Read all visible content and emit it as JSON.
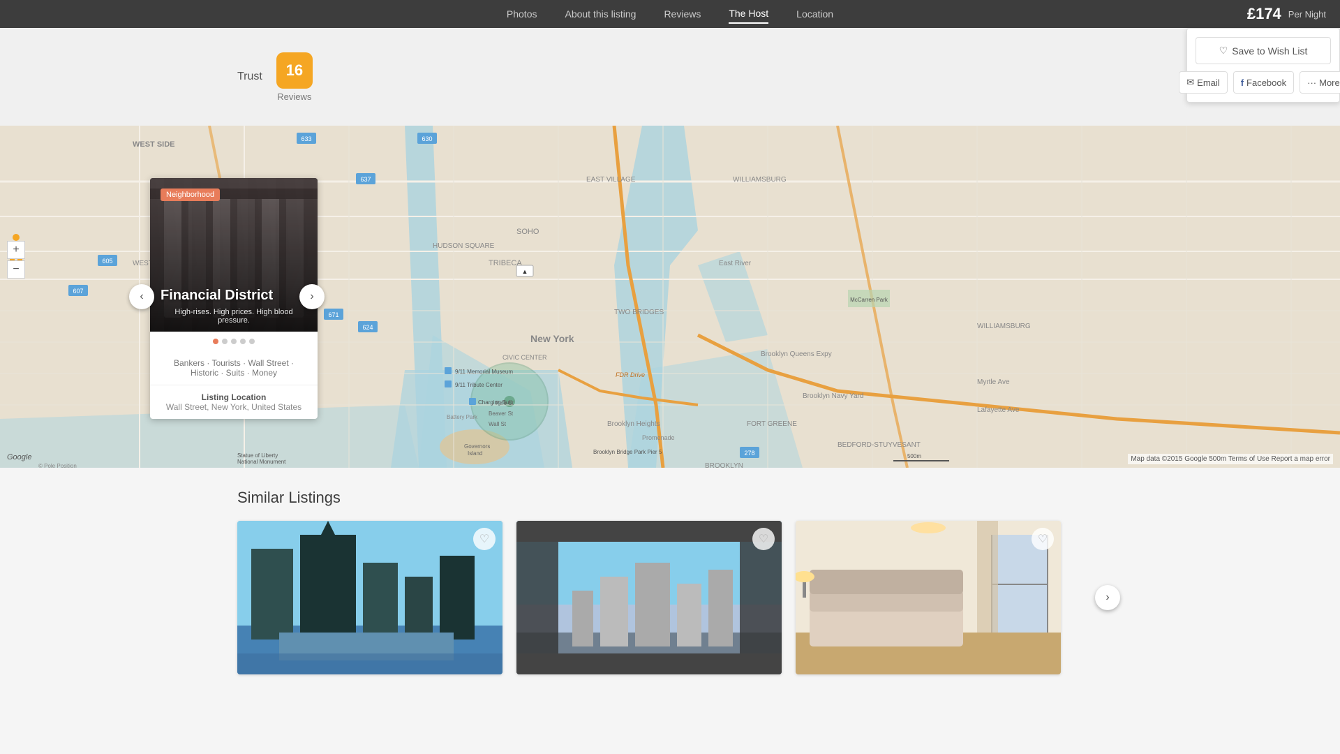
{
  "nav": {
    "links": [
      {
        "label": "Photos",
        "active": false
      },
      {
        "label": "About this listing",
        "active": false
      },
      {
        "label": "Reviews",
        "active": false
      },
      {
        "label": "The Host",
        "active": true
      },
      {
        "label": "Location",
        "active": false
      }
    ]
  },
  "price": {
    "amount": "£174",
    "per_night_label": "Per Night"
  },
  "actions": {
    "wish_list_label": "Save to Wish List",
    "email_label": "Email",
    "facebook_label": "Facebook",
    "more_label": "More"
  },
  "trust": {
    "label": "Trust",
    "badge_number": "16",
    "badge_label": "Reviews"
  },
  "neighborhood": {
    "tag": "Neighborhood",
    "name": "Financial District",
    "description": "High-rises. High prices. High blood pressure.",
    "tags": "Bankers · Tourists · Wall Street · Historic · Suits · Money",
    "listing_location_label": "Listing Location",
    "listing_location_value": "Wall Street, New York, United States"
  },
  "map": {
    "attribution": "Map data ©2015 Google  500m  Terms of Use  Report a map error",
    "logo": "Google"
  },
  "similar": {
    "title": "Similar Listings"
  },
  "map_controls": {
    "zoom_in": "+",
    "zoom_out": "−"
  }
}
